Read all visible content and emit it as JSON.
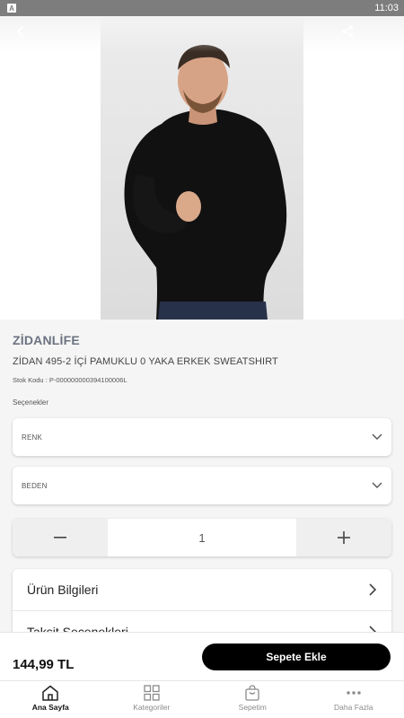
{
  "status_bar": {
    "time": "11:03",
    "app_icon_letter": "A"
  },
  "header": {
    "back_icon": "chevron-left-icon",
    "share_icon": "share-icon"
  },
  "product": {
    "brand": "ZİDANLİFE",
    "name": "ZİDAN 495-2 İÇİ PAMUKLU 0 YAKA ERKEK SWEATSHIRT",
    "sku_text": "Stok Kodu : P-000000000394100006L",
    "photo_alt": "man-wearing-black-sweatshirt"
  },
  "options": {
    "title": "Seçenekler",
    "color_label": "RENK",
    "size_label": "BEDEN"
  },
  "quantity": {
    "value": "1",
    "minus_icon": "minus-icon",
    "plus_icon": "plus-icon"
  },
  "info_sections": [
    {
      "label": "Ürün Bilgileri"
    },
    {
      "label": "Taksit Seçenekleri"
    }
  ],
  "purchase": {
    "price": "144,99 TL",
    "add_to_cart": "Sepete Ekle"
  },
  "tabbar": [
    {
      "label": "Ana Sayfa",
      "icon": "home-icon",
      "active": true
    },
    {
      "label": "Kategoriler",
      "icon": "grid-icon",
      "active": false
    },
    {
      "label": "Sepetim",
      "icon": "cart-icon",
      "active": false
    },
    {
      "label": "Daha Fazla",
      "icon": "more-icon",
      "active": false
    }
  ],
  "colors": {
    "accent": "#000000",
    "brand_text": "#6b7280",
    "status_bar": "#7d7d7d"
  }
}
